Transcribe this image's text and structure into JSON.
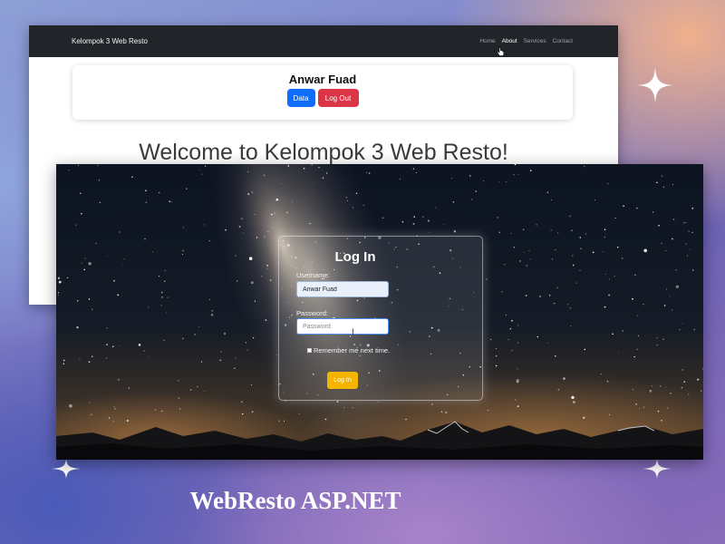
{
  "back_window": {
    "brand": "Kelompok 3 Web Resto",
    "nav": [
      "Home",
      "About",
      "Services",
      "Contact"
    ],
    "active_nav": "About",
    "user_name": "Anwar Fuad",
    "data_button": "Data",
    "logout_button": "Log Out",
    "welcome": "Welcome to Kelompok 3 Web Resto!",
    "colors": {
      "navbar": "#212529",
      "data_button": "#0d6efd",
      "logout_button": "#dc3545"
    }
  },
  "login": {
    "title": "Log In",
    "username_label": "Username:",
    "username_value": "Anwar Fuad",
    "password_label": "Password:",
    "password_placeholder": "Password",
    "remember_label": "Remember me next time.",
    "submit_label": "Log In",
    "colors": {
      "submit": "#f4b400"
    }
  },
  "caption": "WebResto ASP.NET",
  "icons": [
    "sparkle-icon",
    "hand-cursor-icon",
    "text-cursor-icon"
  ]
}
